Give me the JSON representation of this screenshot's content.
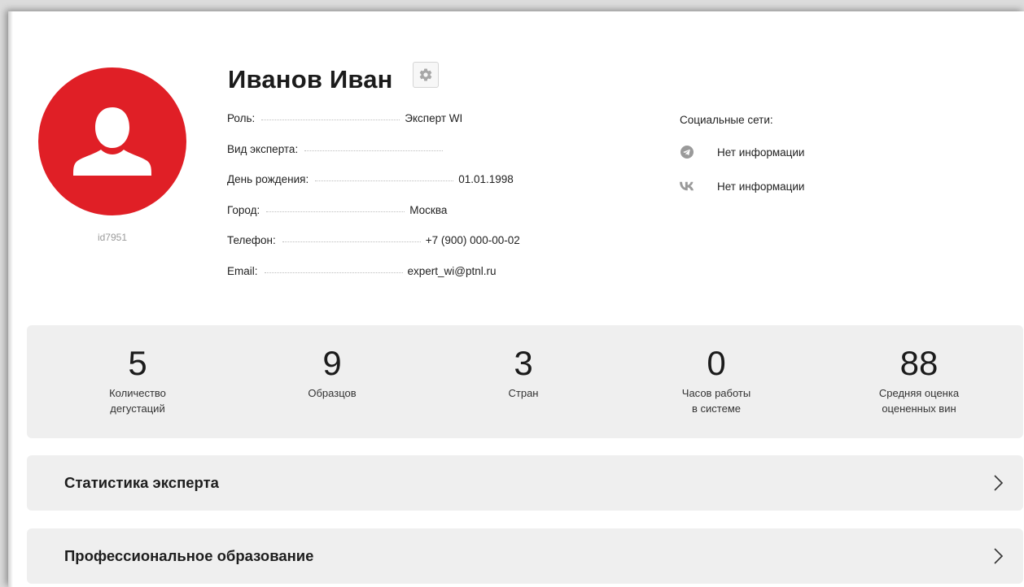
{
  "profile": {
    "name": "Иванов Иван",
    "user_id": "id7951",
    "avatar_color": "#e01f26",
    "settings_icon": "gear-icon"
  },
  "info": {
    "rows": [
      {
        "label": "Роль:",
        "value": "Эксперт WI"
      },
      {
        "label": "Вид эксперта:",
        "value": ""
      },
      {
        "label": "День рождения:",
        "value": "01.01.1998"
      },
      {
        "label": "Город:",
        "value": "Москва"
      },
      {
        "label": "Телефон:",
        "value": "+7 (900) 000-00-02"
      },
      {
        "label": "Email:",
        "value": "expert_wi@ptnl.ru"
      }
    ]
  },
  "social": {
    "title": "Социальные сети:",
    "items": [
      {
        "icon": "telegram-icon",
        "text": "Нет информации"
      },
      {
        "icon": "vk-icon",
        "text": "Нет информации"
      }
    ]
  },
  "stats": [
    {
      "value": "5",
      "label": "Количество\nдегустаций"
    },
    {
      "value": "9",
      "label": "Образцов"
    },
    {
      "value": "3",
      "label": "Стран"
    },
    {
      "value": "0",
      "label": "Часов работы\nв системе"
    },
    {
      "value": "88",
      "label": "Средняя оценка\nоцененных вин"
    }
  ],
  "sections": [
    {
      "title": "Статистика эксперта",
      "icon": "chevron-right-icon"
    },
    {
      "title": "Профессиональное образование",
      "icon": "chevron-right-icon"
    }
  ]
}
